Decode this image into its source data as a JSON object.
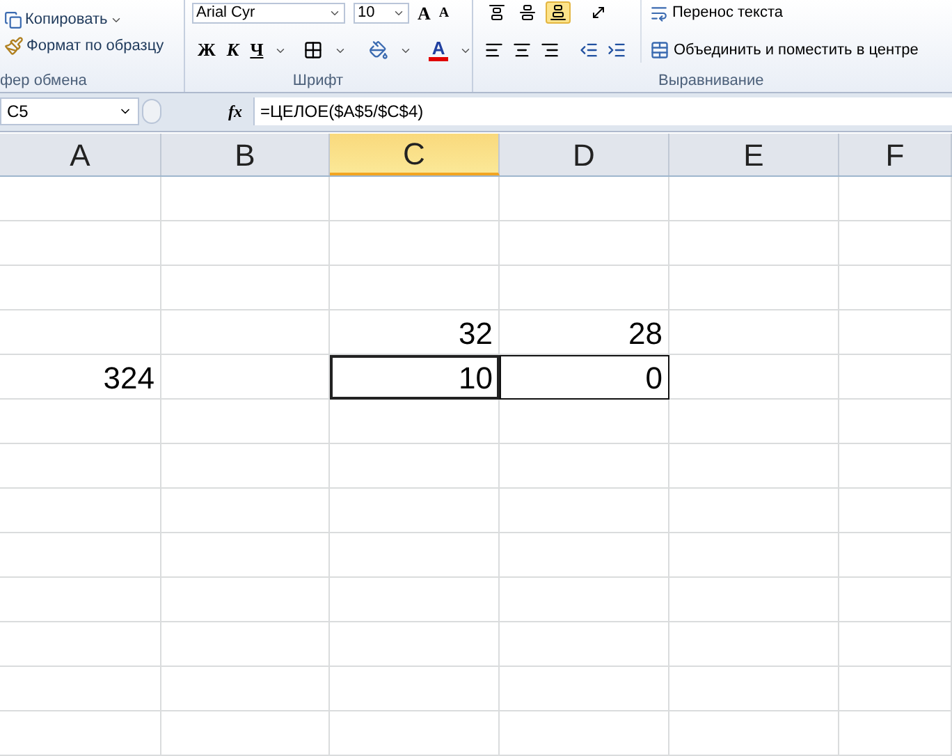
{
  "ribbon": {
    "clipboard": {
      "items": [
        {
          "kind": "copy",
          "label": "Копировать"
        },
        {
          "kind": "painter",
          "label": "Формат по образцу"
        }
      ],
      "group_label": "фер обмена"
    },
    "font": {
      "font_name": "Arial Cyr",
      "font_size": "10",
      "grow_font": "A",
      "shrink_font": "A",
      "bold": "Ж",
      "italic": "К",
      "underline": "Ч",
      "font_color": "A",
      "group_label": "Шрифт"
    },
    "alignment": {
      "top_buttons": [
        {
          "kind": "top",
          "selected": false
        },
        {
          "kind": "middle",
          "selected": false
        },
        {
          "kind": "bottom",
          "selected": true
        }
      ],
      "wrap_label": "Перенос текста",
      "merge_label": "Объединить и поместить в центре",
      "group_label": "Выравнивание"
    }
  },
  "formula_bar": {
    "name_box": "C5",
    "fx": "fx",
    "formula": "=ЦЕЛОЕ($A$5/$C$4)"
  },
  "columns": [
    {
      "label": "A",
      "selected": false
    },
    {
      "label": "B",
      "selected": false
    },
    {
      "label": "C",
      "selected": true
    },
    {
      "label": "D",
      "selected": false
    },
    {
      "label": "E",
      "selected": false
    },
    {
      "label": "F",
      "selected": false
    }
  ],
  "rows": [
    {
      "cells": [
        null,
        null,
        {
          "value": "32",
          "selected": false,
          "bordered": false
        },
        {
          "value": "28",
          "selected": false,
          "bordered": false
        },
        null,
        null
      ]
    },
    {
      "cells": [
        {
          "value": "324",
          "selected": false,
          "bordered": false
        },
        null,
        {
          "value": "10",
          "selected": true,
          "bordered": true
        },
        {
          "value": "0",
          "selected": false,
          "bordered": true
        },
        null,
        null
      ]
    }
  ]
}
